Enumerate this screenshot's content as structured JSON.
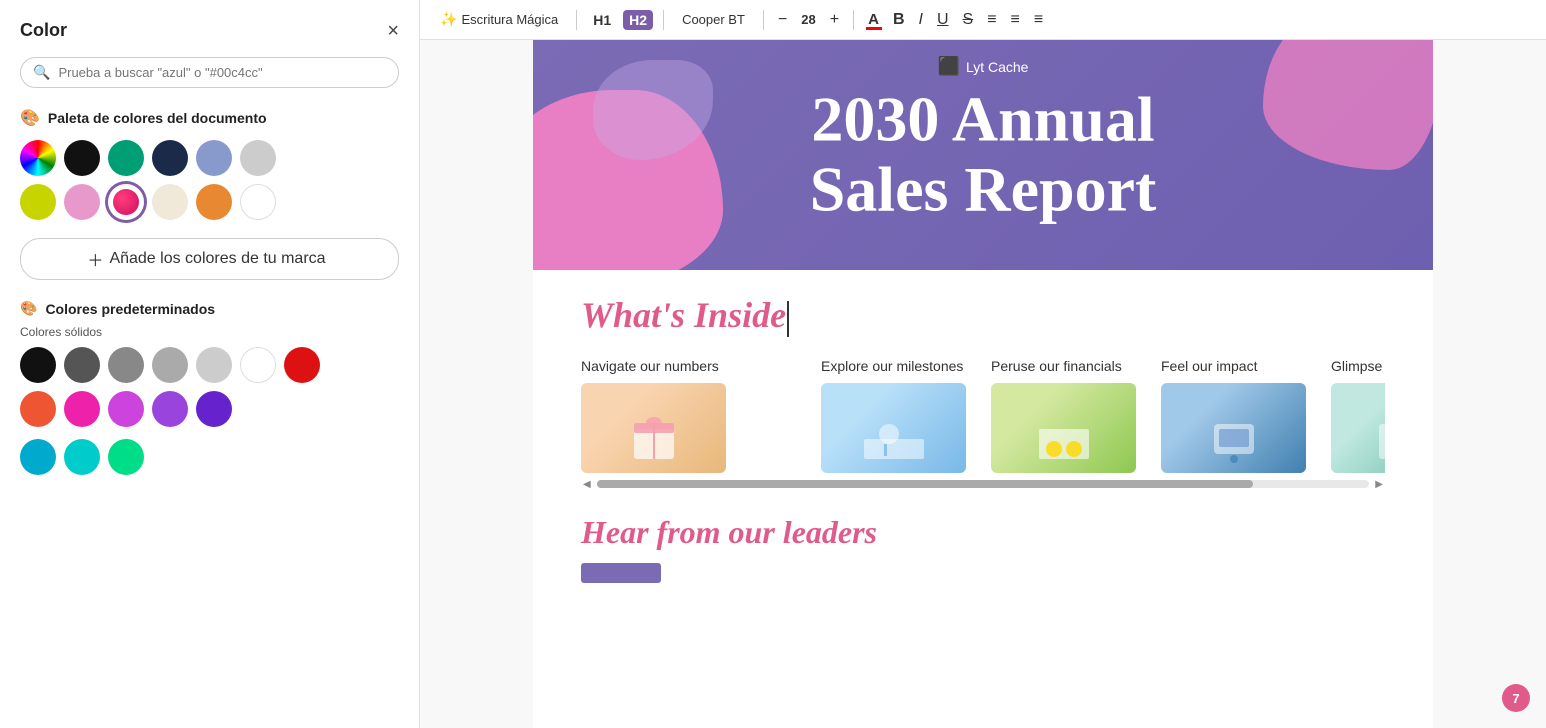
{
  "left_panel": {
    "title": "Color",
    "close_label": "×",
    "search": {
      "placeholder": "Prueba a buscar \"azul\" o \"#00c4cc\""
    },
    "doc_palette_label": "Paleta de colores del documento",
    "doc_palette_icon": "🎨",
    "doc_colors": [
      {
        "id": "rainbow",
        "type": "rainbow",
        "label": "Color wheel"
      },
      {
        "id": "black",
        "hex": "#111111",
        "label": "Black"
      },
      {
        "id": "teal",
        "hex": "#009e74",
        "label": "Teal"
      },
      {
        "id": "dark-navy",
        "hex": "#1a2b4a",
        "label": "Dark navy"
      },
      {
        "id": "periwinkle",
        "hex": "#8899cc",
        "label": "Periwinkle"
      },
      {
        "id": "light-gray",
        "hex": "#cccccc",
        "label": "Light gray"
      },
      {
        "id": "yellow-green",
        "hex": "#c8d400",
        "label": "Yellow green"
      },
      {
        "id": "light-pink",
        "hex": "#e899cc",
        "label": "Light pink"
      },
      {
        "id": "hot-pink",
        "hex": "#e8205a",
        "label": "Hot pink",
        "selected": true
      },
      {
        "id": "cream",
        "hex": "#f0e8d8",
        "label": "Cream"
      },
      {
        "id": "orange",
        "hex": "#e88830",
        "label": "Orange"
      },
      {
        "id": "white",
        "hex": "#ffffff",
        "label": "White",
        "border": true
      }
    ],
    "add_brand_label": "Añade los colores de tu marca",
    "defaults_label": "Colores predeterminados",
    "defaults_icon": "🎨",
    "solid_label": "Colores sólidos",
    "solid_colors": [
      {
        "hex": "#111111",
        "label": "Black"
      },
      {
        "hex": "#555555",
        "label": "Dark gray"
      },
      {
        "hex": "#888888",
        "label": "Medium gray"
      },
      {
        "hex": "#aaaaaa",
        "label": "Light gray 2"
      },
      {
        "hex": "#cccccc",
        "label": "Light gray"
      },
      {
        "hex": "#ffffff",
        "label": "White",
        "border": true
      },
      {
        "hex": "#dd1111",
        "label": "Red"
      },
      {
        "hex": "#ee5533",
        "label": "Orange red"
      },
      {
        "hex": "#ee22aa",
        "label": "Magenta"
      },
      {
        "hex": "#cc44dd",
        "label": "Purple"
      },
      {
        "hex": "#9944dd",
        "label": "Violet"
      },
      {
        "hex": "#6622cc",
        "label": "Deep purple"
      },
      {
        "hex": "#00aacc",
        "label": "Teal blue"
      },
      {
        "hex": "#00cccc",
        "label": "Cyan"
      },
      {
        "hex": "#00dd88",
        "label": "Mint"
      }
    ]
  },
  "toolbar": {
    "magic_label": "Escritura Mágica",
    "h1_label": "H1",
    "h2_label": "H2",
    "font_label": "Cooper BT",
    "font_size": "28",
    "minus_label": "−",
    "plus_label": "+",
    "bold_label": "B",
    "italic_label": "I",
    "underline_label": "U",
    "strikethrough_label": "S",
    "align_label": "≡",
    "list_label": "≡",
    "line_height_label": "≡"
  },
  "editor": {
    "logo_text": "Lyt Cache",
    "banner_title_line1": "2030 Annual",
    "banner_title_line2": "Sales Report",
    "whats_inside_heading": "What's Inside",
    "cards": [
      {
        "label": "Navigate our numbers",
        "img_class": "card-img-1"
      },
      {
        "label": "",
        "img_class": "card-img-blank"
      },
      {
        "label": "Explore our milestones",
        "img_class": "card-img-2"
      },
      {
        "label": "Peruse our financials",
        "img_class": "card-img-3"
      },
      {
        "label": "Feel our impact",
        "img_class": "card-img-4"
      },
      {
        "label": "Glimpse our plans",
        "img_class": "card-img-5"
      }
    ],
    "hear_leaders_heading": "Hear from our leaders",
    "notification_badge": "7"
  }
}
